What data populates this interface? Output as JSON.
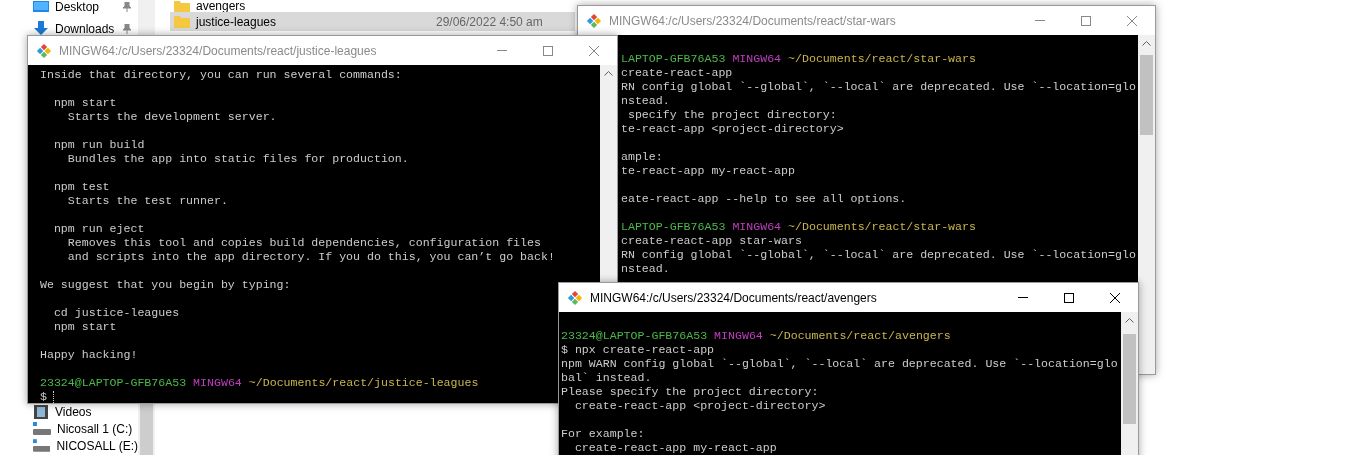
{
  "explorer": {
    "nav_items": [
      {
        "label": "Desktop",
        "kind": "desktop",
        "pinned": true
      },
      {
        "label": "Downloads",
        "kind": "downloads",
        "pinned": true
      },
      {
        "label": "Videos",
        "kind": "videos",
        "pinned": false
      },
      {
        "label": "Nicosall 1 (C:)",
        "kind": "drive",
        "pinned": false
      },
      {
        "label": "NICOSALL (E:)",
        "kind": "drive",
        "pinned": false
      }
    ],
    "files": [
      {
        "name": "avengers",
        "selected": false
      },
      {
        "name": "justice-leagues",
        "date": "29/06/2022 4:50 am",
        "selected": true
      }
    ]
  },
  "windows": [
    {
      "title": "MINGW64:/c/Users/23324/Documents/react/star-wars",
      "active": false,
      "lines": [
        {
          "kind": "blank"
        },
        {
          "kind": "prompt",
          "user": "LAPTOP-GFB76A53",
          "shell": "MINGW64",
          "path": "~/Documents/react/star-wars"
        },
        {
          "kind": "text",
          "text": "create-react-app"
        },
        {
          "kind": "text",
          "text": "RN config global `--global`, `--local` are deprecated. Use `--location=glo"
        },
        {
          "kind": "text",
          "text": "nstead."
        },
        {
          "kind": "text",
          "text": " specify the project directory:"
        },
        {
          "kind": "text",
          "text": "te-react-app <project-directory>"
        },
        {
          "kind": "blank"
        },
        {
          "kind": "text",
          "text": "ample:"
        },
        {
          "kind": "text",
          "text": "te-react-app my-react-app"
        },
        {
          "kind": "blank"
        },
        {
          "kind": "text",
          "text": "eate-react-app --help to see all options."
        },
        {
          "kind": "blank"
        },
        {
          "kind": "prompt",
          "user": "LAPTOP-GFB76A53",
          "shell": "MINGW64",
          "path": "~/Documents/react/star-wars"
        },
        {
          "kind": "text",
          "text": "create-react-app star-wars"
        },
        {
          "kind": "text",
          "text": "RN config global `--global`, `--local` are deprecated. Use `--location=glo"
        },
        {
          "kind": "text",
          "text": "nstead."
        }
      ]
    },
    {
      "title": "MINGW64:/c/Users/23324/Documents/react/justice-leagues",
      "active": false,
      "lines": [
        {
          "kind": "text",
          "text": "Inside that directory, you can run several commands:"
        },
        {
          "kind": "blank"
        },
        {
          "kind": "text",
          "text": "  npm start"
        },
        {
          "kind": "text",
          "text": "    Starts the development server."
        },
        {
          "kind": "blank"
        },
        {
          "kind": "text",
          "text": "  npm run build"
        },
        {
          "kind": "text",
          "text": "    Bundles the app into static files for production."
        },
        {
          "kind": "blank"
        },
        {
          "kind": "text",
          "text": "  npm test"
        },
        {
          "kind": "text",
          "text": "    Starts the test runner."
        },
        {
          "kind": "blank"
        },
        {
          "kind": "text",
          "text": "  npm run eject"
        },
        {
          "kind": "text",
          "text": "    Removes this tool and copies build dependencies, configuration files"
        },
        {
          "kind": "text",
          "text": "    and scripts into the app directory. If you do this, you can’t go back!"
        },
        {
          "kind": "blank"
        },
        {
          "kind": "text",
          "text": "We suggest that you begin by typing:"
        },
        {
          "kind": "blank"
        },
        {
          "kind": "text",
          "text": "  cd justice-leagues"
        },
        {
          "kind": "text",
          "text": "  npm start"
        },
        {
          "kind": "blank"
        },
        {
          "kind": "text",
          "text": "Happy hacking!"
        },
        {
          "kind": "blank"
        },
        {
          "kind": "prompt",
          "user": "23324@LAPTOP-GFB76A53",
          "shell": "MINGW64",
          "path": "~/Documents/react/justice-leagues"
        },
        {
          "kind": "input",
          "text": "$"
        }
      ]
    },
    {
      "title": "MINGW64:/c/Users/23324/Documents/react/avengers",
      "active": true,
      "lines": [
        {
          "kind": "blank"
        },
        {
          "kind": "prompt",
          "user": "23324@LAPTOP-GFB76A53",
          "shell": "MINGW64",
          "path": "~/Documents/react/avengers"
        },
        {
          "kind": "text",
          "text": "$ npx create-react-app"
        },
        {
          "kind": "text",
          "text": "npm WARN config global `--global`, `--local` are deprecated. Use `--location=glo"
        },
        {
          "kind": "text",
          "text": "bal` instead."
        },
        {
          "kind": "text",
          "text": "Please specify the project directory:"
        },
        {
          "kind": "text",
          "text": "  create-react-app <project-directory>"
        },
        {
          "kind": "blank"
        },
        {
          "kind": "text",
          "text": "For example:"
        },
        {
          "kind": "text",
          "text": "  create-react-app my-react-app"
        }
      ]
    }
  ]
}
